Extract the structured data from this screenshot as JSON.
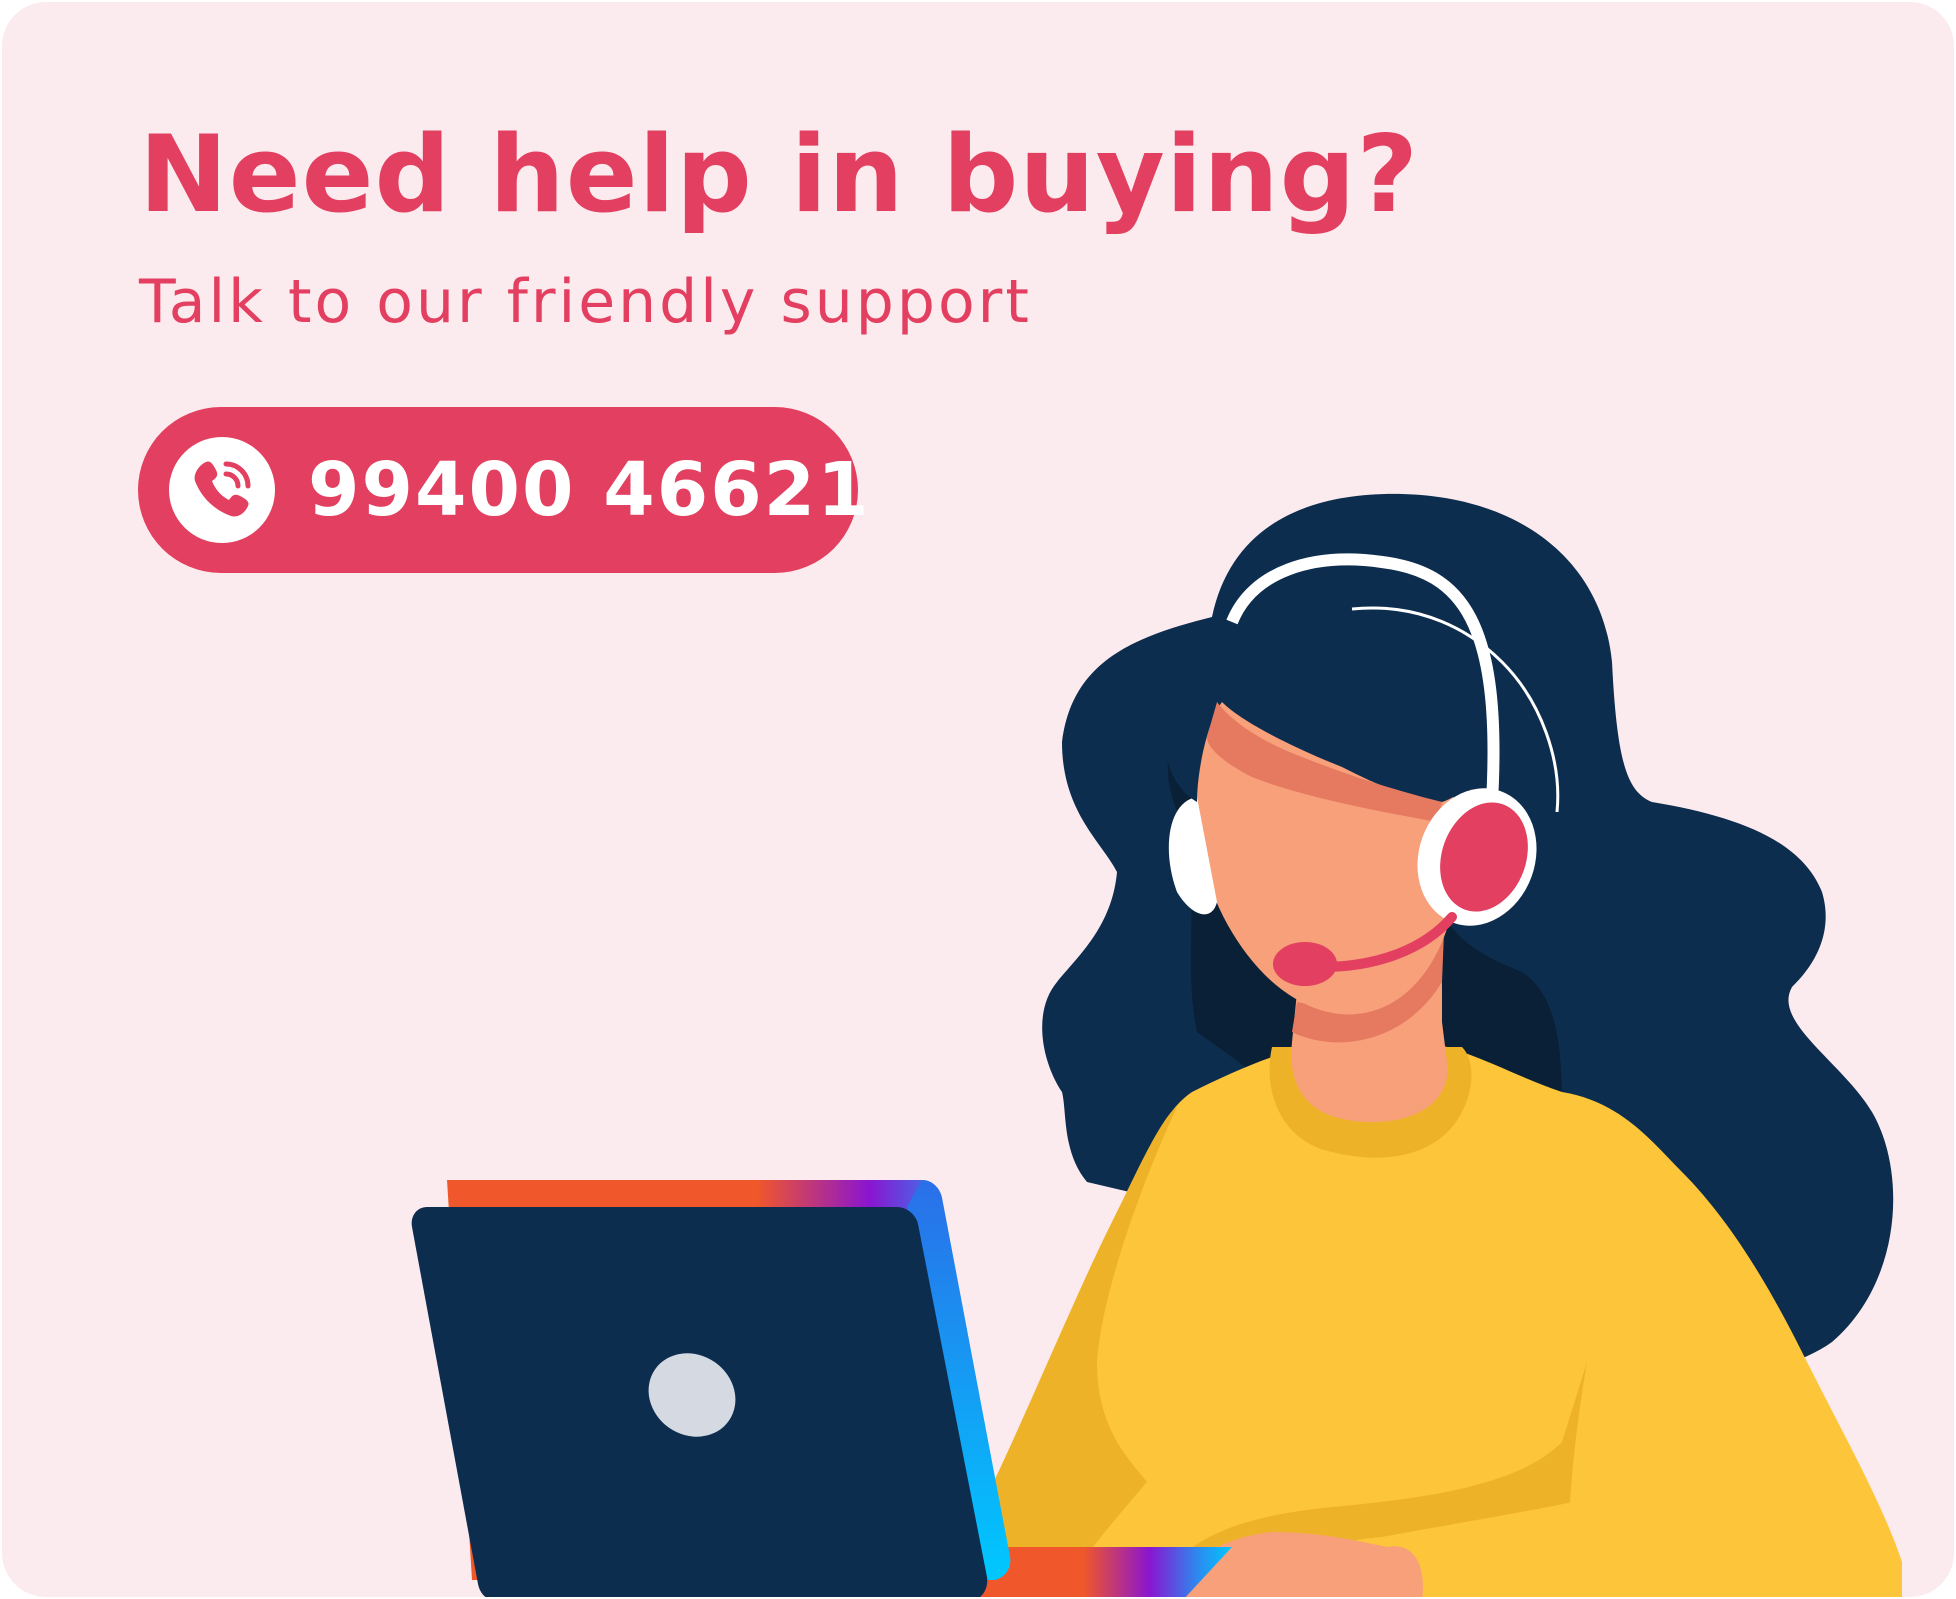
{
  "hero": {
    "headline": "Need help in buying?",
    "subheadline": "Talk to our friendly support"
  },
  "call_button": {
    "phone_number": "99400 46621",
    "icon": "phone-call-icon"
  },
  "illustration": {
    "subject": "support-agent-with-headset-and-laptop"
  },
  "colors": {
    "background": "#fcebee",
    "accent": "#e33f60",
    "navy": "#0d2d4f",
    "skin": "#f7a07a",
    "sweater": "#fdc53a"
  }
}
